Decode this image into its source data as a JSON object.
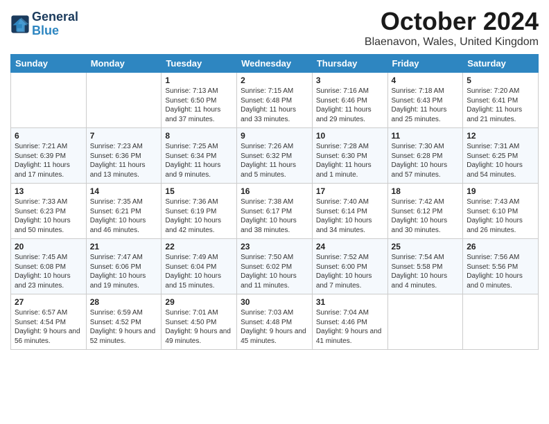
{
  "header": {
    "logo_line1": "General",
    "logo_line2": "Blue",
    "month": "October 2024",
    "location": "Blaenavon, Wales, United Kingdom"
  },
  "days_of_week": [
    "Sunday",
    "Monday",
    "Tuesday",
    "Wednesday",
    "Thursday",
    "Friday",
    "Saturday"
  ],
  "weeks": [
    [
      {
        "day": "",
        "info": ""
      },
      {
        "day": "",
        "info": ""
      },
      {
        "day": "1",
        "info": "Sunrise: 7:13 AM\nSunset: 6:50 PM\nDaylight: 11 hours and 37 minutes."
      },
      {
        "day": "2",
        "info": "Sunrise: 7:15 AM\nSunset: 6:48 PM\nDaylight: 11 hours and 33 minutes."
      },
      {
        "day": "3",
        "info": "Sunrise: 7:16 AM\nSunset: 6:46 PM\nDaylight: 11 hours and 29 minutes."
      },
      {
        "day": "4",
        "info": "Sunrise: 7:18 AM\nSunset: 6:43 PM\nDaylight: 11 hours and 25 minutes."
      },
      {
        "day": "5",
        "info": "Sunrise: 7:20 AM\nSunset: 6:41 PM\nDaylight: 11 hours and 21 minutes."
      }
    ],
    [
      {
        "day": "6",
        "info": "Sunrise: 7:21 AM\nSunset: 6:39 PM\nDaylight: 11 hours and 17 minutes."
      },
      {
        "day": "7",
        "info": "Sunrise: 7:23 AM\nSunset: 6:36 PM\nDaylight: 11 hours and 13 minutes."
      },
      {
        "day": "8",
        "info": "Sunrise: 7:25 AM\nSunset: 6:34 PM\nDaylight: 11 hours and 9 minutes."
      },
      {
        "day": "9",
        "info": "Sunrise: 7:26 AM\nSunset: 6:32 PM\nDaylight: 11 hours and 5 minutes."
      },
      {
        "day": "10",
        "info": "Sunrise: 7:28 AM\nSunset: 6:30 PM\nDaylight: 11 hours and 1 minute."
      },
      {
        "day": "11",
        "info": "Sunrise: 7:30 AM\nSunset: 6:28 PM\nDaylight: 10 hours and 57 minutes."
      },
      {
        "day": "12",
        "info": "Sunrise: 7:31 AM\nSunset: 6:25 PM\nDaylight: 10 hours and 54 minutes."
      }
    ],
    [
      {
        "day": "13",
        "info": "Sunrise: 7:33 AM\nSunset: 6:23 PM\nDaylight: 10 hours and 50 minutes."
      },
      {
        "day": "14",
        "info": "Sunrise: 7:35 AM\nSunset: 6:21 PM\nDaylight: 10 hours and 46 minutes."
      },
      {
        "day": "15",
        "info": "Sunrise: 7:36 AM\nSunset: 6:19 PM\nDaylight: 10 hours and 42 minutes."
      },
      {
        "day": "16",
        "info": "Sunrise: 7:38 AM\nSunset: 6:17 PM\nDaylight: 10 hours and 38 minutes."
      },
      {
        "day": "17",
        "info": "Sunrise: 7:40 AM\nSunset: 6:14 PM\nDaylight: 10 hours and 34 minutes."
      },
      {
        "day": "18",
        "info": "Sunrise: 7:42 AM\nSunset: 6:12 PM\nDaylight: 10 hours and 30 minutes."
      },
      {
        "day": "19",
        "info": "Sunrise: 7:43 AM\nSunset: 6:10 PM\nDaylight: 10 hours and 26 minutes."
      }
    ],
    [
      {
        "day": "20",
        "info": "Sunrise: 7:45 AM\nSunset: 6:08 PM\nDaylight: 10 hours and 23 minutes."
      },
      {
        "day": "21",
        "info": "Sunrise: 7:47 AM\nSunset: 6:06 PM\nDaylight: 10 hours and 19 minutes."
      },
      {
        "day": "22",
        "info": "Sunrise: 7:49 AM\nSunset: 6:04 PM\nDaylight: 10 hours and 15 minutes."
      },
      {
        "day": "23",
        "info": "Sunrise: 7:50 AM\nSunset: 6:02 PM\nDaylight: 10 hours and 11 minutes."
      },
      {
        "day": "24",
        "info": "Sunrise: 7:52 AM\nSunset: 6:00 PM\nDaylight: 10 hours and 7 minutes."
      },
      {
        "day": "25",
        "info": "Sunrise: 7:54 AM\nSunset: 5:58 PM\nDaylight: 10 hours and 4 minutes."
      },
      {
        "day": "26",
        "info": "Sunrise: 7:56 AM\nSunset: 5:56 PM\nDaylight: 10 hours and 0 minutes."
      }
    ],
    [
      {
        "day": "27",
        "info": "Sunrise: 6:57 AM\nSunset: 4:54 PM\nDaylight: 9 hours and 56 minutes."
      },
      {
        "day": "28",
        "info": "Sunrise: 6:59 AM\nSunset: 4:52 PM\nDaylight: 9 hours and 52 minutes."
      },
      {
        "day": "29",
        "info": "Sunrise: 7:01 AM\nSunset: 4:50 PM\nDaylight: 9 hours and 49 minutes."
      },
      {
        "day": "30",
        "info": "Sunrise: 7:03 AM\nSunset: 4:48 PM\nDaylight: 9 hours and 45 minutes."
      },
      {
        "day": "31",
        "info": "Sunrise: 7:04 AM\nSunset: 4:46 PM\nDaylight: 9 hours and 41 minutes."
      },
      {
        "day": "",
        "info": ""
      },
      {
        "day": "",
        "info": ""
      }
    ]
  ]
}
